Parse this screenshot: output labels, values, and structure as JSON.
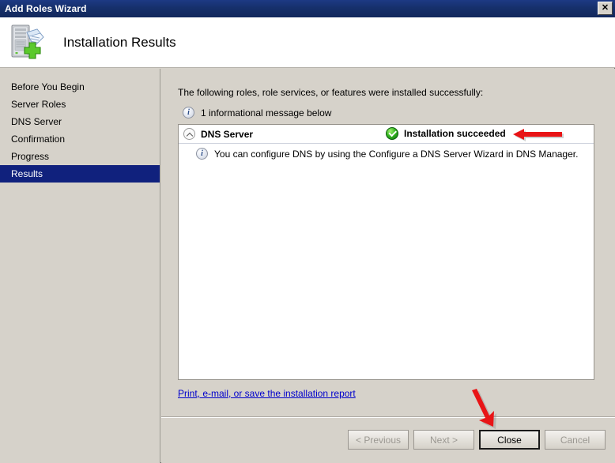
{
  "window": {
    "title": "Add Roles Wizard",
    "close_glyph": "✕",
    "close_name": "Close"
  },
  "header": {
    "title": "Installation Results",
    "icon": "server-install-icon"
  },
  "sidebar": {
    "items": [
      {
        "label": "Before You Begin",
        "selected": false
      },
      {
        "label": "Server Roles",
        "selected": false
      },
      {
        "label": "DNS Server",
        "selected": false
      },
      {
        "label": "Confirmation",
        "selected": false
      },
      {
        "label": "Progress",
        "selected": false
      },
      {
        "label": "Results",
        "selected": true
      }
    ]
  },
  "main": {
    "intro_text": "The following roles, role services, or features were installed successfully:",
    "message_count_text": "1 informational message below",
    "message_icon": "info-icon",
    "results": {
      "role_name": "DNS Server",
      "status_text": "Installation succeeded",
      "status_icon": "green-check-icon",
      "collapse_icon": "chevron-up-icon",
      "detail_icon": "info-icon",
      "detail_text": "You can configure DNS by using the Configure a DNS Server Wizard in DNS Manager."
    },
    "report_link": "Print, e-mail, or save the installation report"
  },
  "footer": {
    "buttons": [
      {
        "label": "< Previous",
        "state": "disabled"
      },
      {
        "label": "Next >",
        "state": "disabled"
      },
      {
        "label": "Close",
        "state": "default"
      },
      {
        "label": "Cancel",
        "state": "disabled"
      }
    ]
  },
  "annotations": {
    "arrow_status": "red-arrow-pointing-left",
    "arrow_close": "red-arrow-pointing-down"
  },
  "colors": {
    "titlebar": "#16306b",
    "selection": "#10217d",
    "link": "#0000cc",
    "success": "#2a9e1e",
    "annotation": "#e81416",
    "dialog_face": "#d6d2ca"
  }
}
